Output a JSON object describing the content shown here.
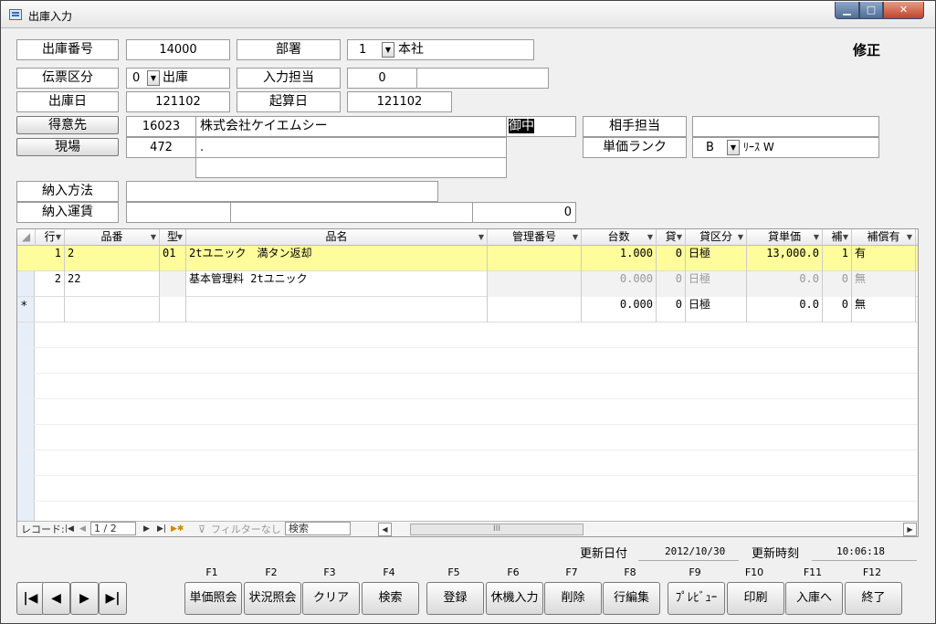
{
  "window": {
    "title": "出庫入力"
  },
  "mode_label": "修正",
  "header": {
    "shukko_no_label": "出庫番号",
    "shukko_no": "14000",
    "busho_label": "部署",
    "busho_code": "1",
    "busho_name": "本社",
    "denpyo_label": "伝票区分",
    "denpyo_code": "0",
    "denpyo_name": "出庫",
    "nyuryoku_label": "入力担当",
    "nyuryoku_code": "0",
    "nyuryoku_name": "",
    "shukko_date_label": "出庫日",
    "shukko_date": "121102",
    "kisan_label": "起算日",
    "kisan_date": "121102",
    "tokuisaki_label": "得意先",
    "tokuisaki_code": "16023",
    "tokuisaki_name": "株式会社ケイエムシー",
    "honorific": "御中",
    "genba_label": "現場",
    "genba_code": "472",
    "genba_name": ".",
    "genba_addr": "",
    "aite_label": "相手担当",
    "aite_value": "",
    "rank_label": "単価ランク",
    "rank_code": "B",
    "rank_name": "ﾘｰｽ W",
    "nonyu_label": "納入方法",
    "nonyu_value": "",
    "unchin_label": "納入運賃",
    "unchin_a": "",
    "unchin_b": "",
    "unchin_amount": "0"
  },
  "grid": {
    "columns": [
      "行",
      "品番",
      "型",
      "品名",
      "管理番号",
      "台数",
      "貸",
      "貸区分",
      "貸単価",
      "補",
      "補償有"
    ],
    "rows": [
      {
        "no": "1",
        "hinban": "2",
        "kata": "01",
        "hinmei": "2tユニック　満タン返却",
        "kanri": "",
        "daisu": "1.000",
        "kashi": "0",
        "kubun": "日極",
        "tanka": "13,000.0",
        "ho": "1",
        "hosho": "有"
      },
      {
        "no": "2",
        "hinban": "22",
        "kata": "",
        "hinmei": "基本管理料 2tユニック",
        "kanri": "",
        "daisu": "0.000",
        "kashi": "0",
        "kubun": "日極",
        "tanka": "0.0",
        "ho": "0",
        "hosho": "無"
      },
      {
        "no": "",
        "hinban": "",
        "kata": "",
        "hinmei": "",
        "kanri": "",
        "daisu": "0.000",
        "kashi": "0",
        "kubun": "日極",
        "tanka": "0.0",
        "ho": "0",
        "hosho": "無"
      }
    ],
    "new_row_marker": "*"
  },
  "navbar": {
    "record_label": "レコード:",
    "position": "1 / 2",
    "filter_label": "フィルターなし",
    "search_label": "検索",
    "scroll_mark": "III"
  },
  "update": {
    "date_label": "更新日付",
    "date": "2012/10/30",
    "time_label": "更新時刻",
    "time": "10:06:18"
  },
  "fkeys": [
    "F1",
    "F2",
    "F3",
    "F4",
    "F5",
    "F6",
    "F7",
    "F8",
    "F9",
    "F10",
    "F11",
    "F12"
  ],
  "buttons": [
    "単価照会",
    "状況照会",
    "クリア",
    "検索",
    "登録",
    "休機入力",
    "削除",
    "行編集",
    "ﾌﾟﾚﾋﾞｭｰ",
    "印刷",
    "入庫へ",
    "終了"
  ],
  "nav_buttons": [
    "|◀",
    "◀",
    "▶",
    "▶|"
  ],
  "colors": {
    "selected_row": "#fffc9c",
    "window_bg": "#f0f0f0"
  }
}
